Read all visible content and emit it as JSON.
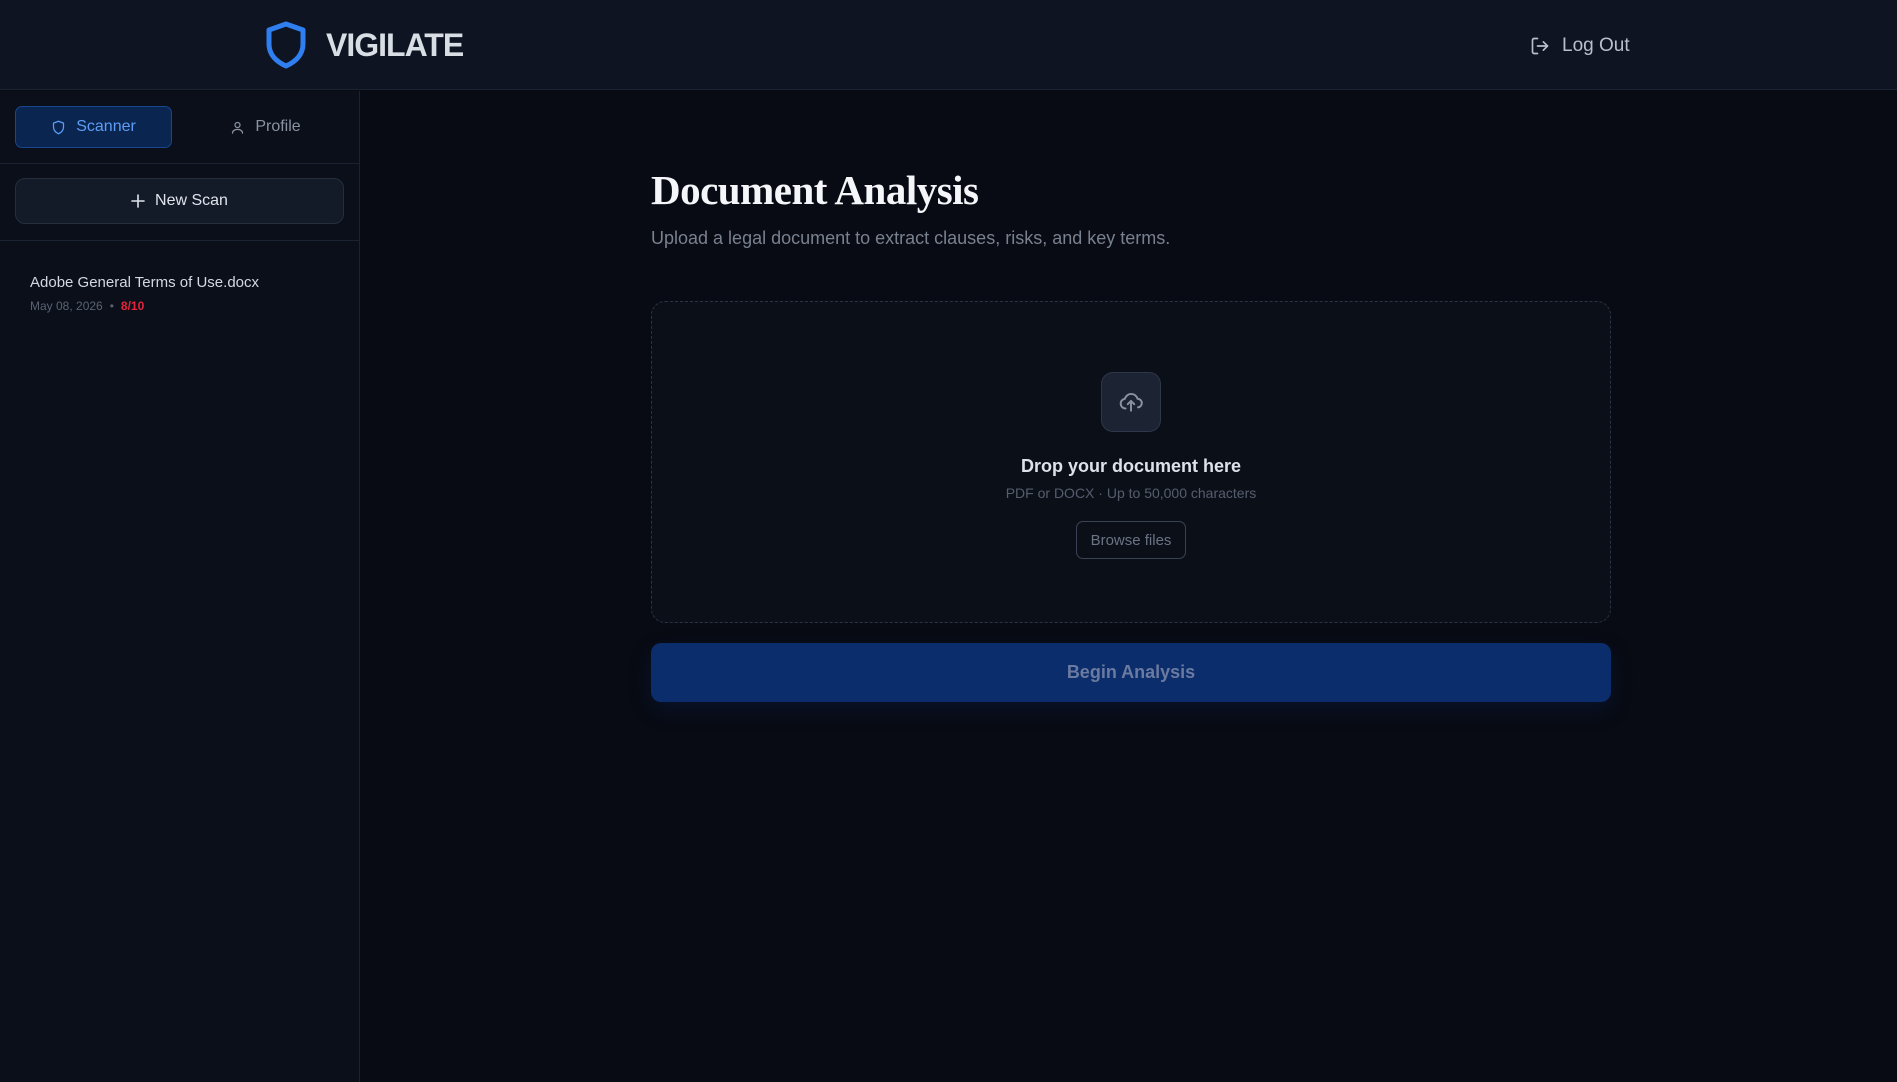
{
  "header": {
    "brand_name": "VIGILATE",
    "logout_label": "Log Out"
  },
  "sidebar": {
    "tabs": [
      {
        "label": "Scanner",
        "icon": "shield-icon",
        "active": true
      },
      {
        "label": "Profile",
        "icon": "user-icon",
        "active": false
      }
    ],
    "new_scan_label": "New Scan",
    "scans": [
      {
        "name": "Adobe General Terms of Use.docx",
        "date": "May 08, 2026",
        "separator": "•",
        "score": "8/10"
      }
    ]
  },
  "main": {
    "title": "Document Analysis",
    "subtitle": "Upload a legal document to extract clauses, risks, and key terms.",
    "dropzone": {
      "title": "Drop your document here",
      "subtitle": "PDF or DOCX · Up to 50,000 characters",
      "browse_label": "Browse files"
    },
    "begin_label": "Begin Analysis"
  },
  "colors": {
    "accent": "#2f7ff0",
    "score_high": "#e5253b",
    "button_primary": "#0b2d6b"
  }
}
